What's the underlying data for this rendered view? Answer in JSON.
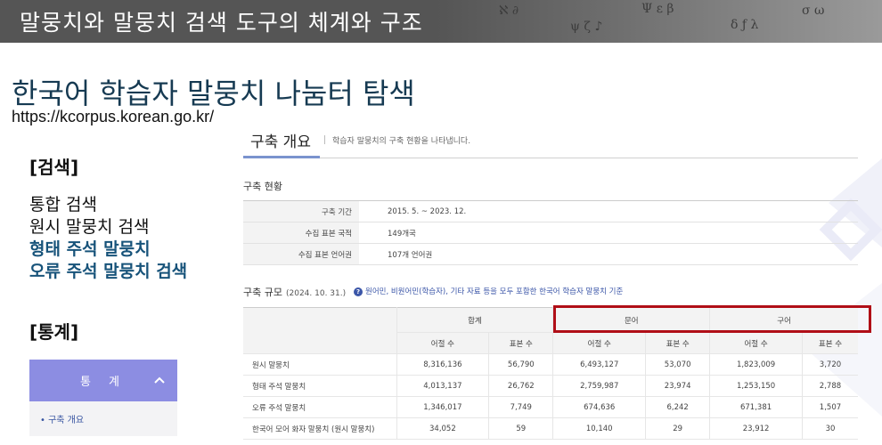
{
  "banner": {
    "title": "말뭉치와 말뭉치 검색 도구의 체계와 구조"
  },
  "site": {
    "title": "한국어 학습자 말뭉치 나눔터 탐색",
    "url": "https://kcorpus.korean.go.kr/"
  },
  "search_section": {
    "heading": "[검색]",
    "items": [
      {
        "label": "통합 검색",
        "highlight": false
      },
      {
        "label": "원시 말뭉치 검색",
        "highlight": false
      },
      {
        "label": "형태 주석 말뭉치",
        "highlight": true
      },
      {
        "label": "오류 주석 말뭉치 검색",
        "highlight": true
      }
    ]
  },
  "stats_section": {
    "heading": "[통계]",
    "box_title": "통 계",
    "link": "• 구축 개요"
  },
  "panel": {
    "tab_title": "구축 개요",
    "tab_desc": "학습자 말뭉치의 구축 현황을 나타냅니다.",
    "status_title": "구축 현황",
    "status_rows": [
      {
        "label": "구축 기간",
        "value": "2015. 5. ~ 2023. 12."
      },
      {
        "label": "수집 표본 국적",
        "value": "149개국"
      },
      {
        "label": "수집 표본 언어권",
        "value": "107개 언어권"
      }
    ],
    "scale_title": "구축 규모",
    "scale_date": "(2024. 10. 31.)",
    "scale_note": "원어민, 비원어민(학습자), 기타 자료 등을 모두 포함한 한국어 학습자 말뭉치 기준",
    "groups": [
      "합계",
      "문어",
      "구어"
    ],
    "sub_headers": [
      "어절 수",
      "표본 수",
      "어절 수",
      "표본 수",
      "어절 수",
      "표본 수"
    ],
    "rows": [
      {
        "name": "원시 말뭉치",
        "values": [
          "8,316,136",
          "56,790",
          "6,493,127",
          "53,070",
          "1,823,009",
          "3,720"
        ]
      },
      {
        "name": "형태 주석 말뭉치",
        "values": [
          "4,013,137",
          "26,762",
          "2,759,987",
          "23,974",
          "1,253,150",
          "2,788"
        ]
      },
      {
        "name": "오류 주석 말뭉치",
        "values": [
          "1,346,017",
          "7,749",
          "674,636",
          "6,242",
          "671,381",
          "1,507"
        ]
      },
      {
        "name": "한국어 모어 화자 말뭉치 (원시 말뭉치)",
        "values": [
          "34,052",
          "59",
          "10,140",
          "29",
          "23,912",
          "30"
        ]
      }
    ]
  },
  "colors": {
    "banner": "#555555",
    "accent": "#8c8de2",
    "highlight_box": "#b00e17",
    "link": "#17537a"
  }
}
